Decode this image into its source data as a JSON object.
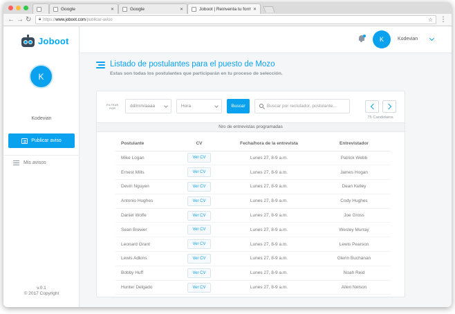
{
  "browser": {
    "tabs": [
      {
        "title": ""
      },
      {
        "title": "Google"
      },
      {
        "title": "Google"
      },
      {
        "title": "Joboot | Reinventa tu form..."
      }
    ],
    "url_scheme": "https://",
    "url_host": "www.joboot.com",
    "url_path": "/publicar-aviso"
  },
  "brand": {
    "name": "Joboot"
  },
  "user": {
    "initial": "K",
    "name": "Kodevian"
  },
  "sidebar": {
    "publish_label": "Publicar aviso",
    "nav": [
      {
        "label": "Mis avisos"
      }
    ],
    "version": "v.0.1",
    "copyright": "© 2017 Copyright"
  },
  "page": {
    "title": "Listado de postulantes para el puesto de Mozo",
    "subtitle": "Estas son todas los postulantes que participarán en tu proceso de selección."
  },
  "filters": {
    "label_line1": "FILTRAR",
    "label_line2": "POR",
    "date_placeholder": "dd/mm/aaaa",
    "hour_placeholder": "Hora",
    "search_button": "Buscar",
    "search_placeholder": "Buscar por reclutador, postulante..."
  },
  "pagination": {
    "count_label": "75 Candidatos"
  },
  "table": {
    "section_label": "Nro de entrevistas programadas",
    "headers": [
      "Postulante",
      "CV",
      "Fecha/hora de la entrevista",
      "Entrevistador"
    ],
    "cv_label": "Ver CV",
    "rows": [
      {
        "name": "Mike Logan",
        "datetime": "Lunes 27, 8-9 a.m.",
        "interviewer": "Patrick Webb"
      },
      {
        "name": "Ernest Mills",
        "datetime": "Lunes 27, 8-9 a.m.",
        "interviewer": "James Hogan"
      },
      {
        "name": "Devin Nguyen",
        "datetime": "Lunes 27, 8-9 a.m.",
        "interviewer": "Dean Kelley"
      },
      {
        "name": "Antonio Hughes",
        "datetime": "Lunes 27, 8-9 a.m.",
        "interviewer": "Cody Hughes"
      },
      {
        "name": "Daniel Wolfe",
        "datetime": "Lunes 27, 8-9 a.m.",
        "interviewer": "Joe Gross"
      },
      {
        "name": "Sean Brewer",
        "datetime": "Lunes 27, 8-9 a.m.",
        "interviewer": "Wesley Murray"
      },
      {
        "name": "Leonard Grant",
        "datetime": "Lunes 27, 8-9 a.m.",
        "interviewer": "Lewis Pearson"
      },
      {
        "name": "Lewis Adkins",
        "datetime": "Lunes 27, 8-9 a.m.",
        "interviewer": "Glenn Buchanan"
      },
      {
        "name": "Bobby Huff",
        "datetime": "Lunes 27, 8-9 a.m.",
        "interviewer": "Noah Reid"
      },
      {
        "name": "Hunter Delgado",
        "datetime": "Lunes 27, 8-9 a.m.",
        "interviewer": "Allen Nelson"
      }
    ]
  },
  "colors": {
    "accent": "#0aa2ee",
    "sidebar_bg": "#ffffff",
    "page_bg": "#f4f6f8"
  }
}
